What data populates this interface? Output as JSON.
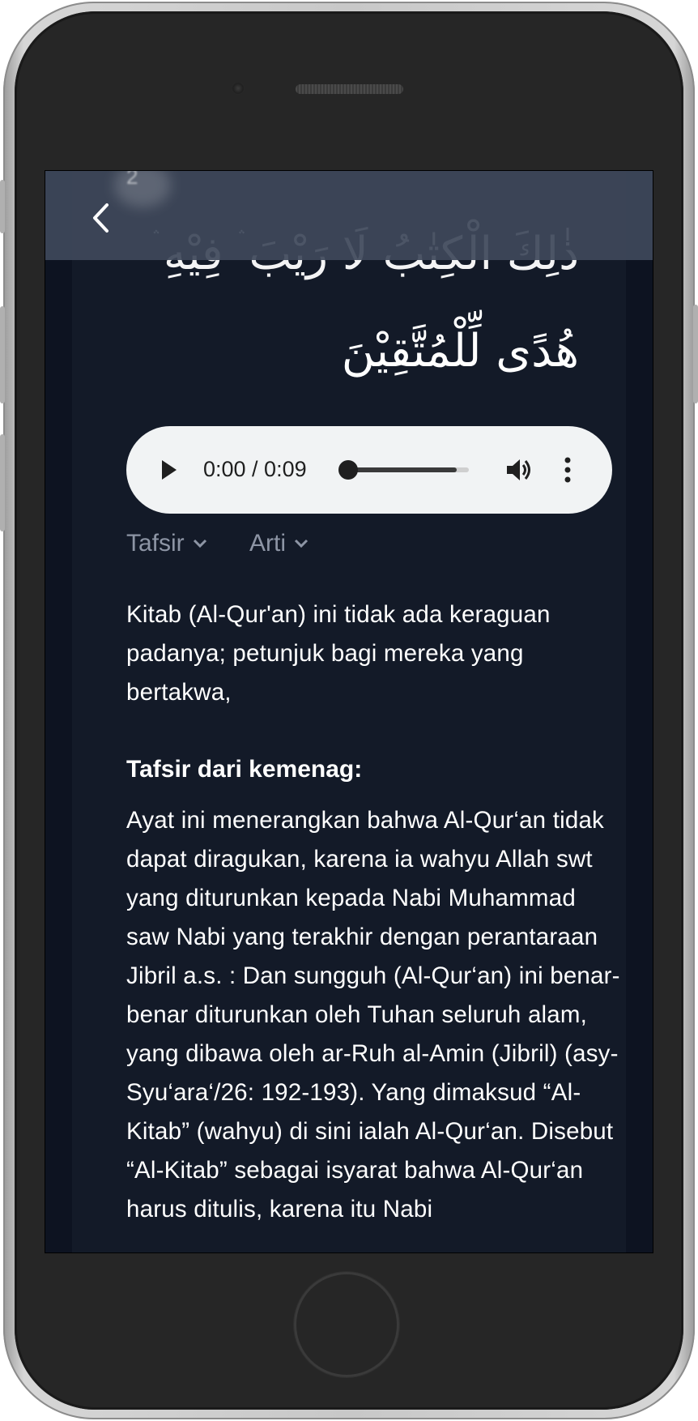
{
  "header": {
    "back_icon": "chevron-left-icon",
    "scrolled_number": "2"
  },
  "ayah": {
    "arabic_line_1": "ذٰلِكَ الْكِتٰبُ لَا رَيْبَ ۛ فِيْهِ ۛ",
    "arabic_line_2": "هُدًى لِّلْمُتَّقِيْنَ"
  },
  "audio": {
    "time": "0:00 / 0:09",
    "progress": 0.9,
    "play_icon": "play-icon",
    "volume_icon": "volume-icon",
    "menu_icon": "more-vertical-icon"
  },
  "dropdowns": {
    "tafsir_label": "Tafsir",
    "arti_label": "Arti"
  },
  "translation": "Kitab (Al-Qur'an) ini tidak ada keraguan padanya; petunjuk bagi mereka yang bertakwa,",
  "tafsir": {
    "title": "Tafsir dari kemenag:",
    "text": "Ayat ini menerangkan bahwa Al-Qur‘an tidak dapat diragukan, karena ia wahyu Allah swt yang diturunkan kepada Nabi Muhammad saw Nabi yang terakhir dengan perantaraan Jibril a.s. : Dan sungguh (Al-Qur‘an) ini benar-benar diturunkan oleh Tuhan seluruh alam, yang dibawa oleh ar-Ruh al-Amin (Jibril) (asy-Syu‘ara‘/26: 192-193). Yang dimaksud “Al-Kitab” (wahyu) di sini ialah Al-Qur‘an. Disebut “Al-Kitab” sebagai isyarat bahwa Al-Qur‘an harus ditulis, karena itu Nabi"
  }
}
